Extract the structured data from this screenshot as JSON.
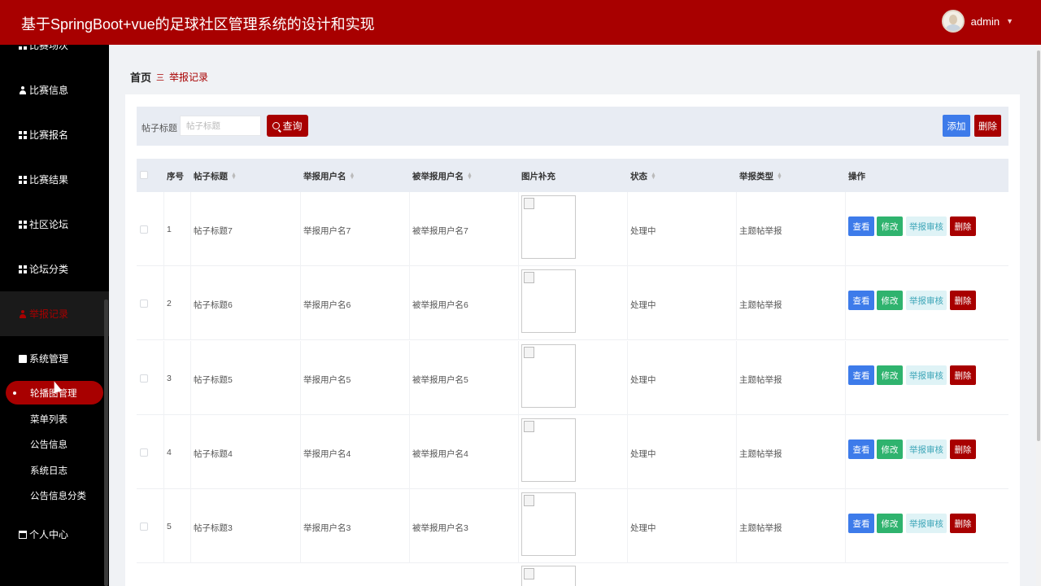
{
  "header": {
    "title": "基于SpringBoot+vue的足球社区管理系统的设计和实现",
    "user_name": "admin"
  },
  "sidebar": {
    "items": [
      {
        "label": "比赛场次",
        "icon": "grid-icon"
      },
      {
        "label": "比赛信息",
        "icon": "user-icon"
      },
      {
        "label": "比赛报名",
        "icon": "grid-icon"
      },
      {
        "label": "比赛结果",
        "icon": "grid-icon"
      },
      {
        "label": "社区论坛",
        "icon": "grid-icon"
      },
      {
        "label": "论坛分类",
        "icon": "grid-icon"
      },
      {
        "label": "举报记录",
        "icon": "user-icon",
        "active": true
      },
      {
        "label": "系统管理",
        "icon": "document-icon"
      }
    ],
    "sub_items": [
      {
        "label": "轮播图管理",
        "active": true
      },
      {
        "label": "菜单列表"
      },
      {
        "label": "公告信息"
      },
      {
        "label": "系统日志"
      },
      {
        "label": "公告信息分类"
      }
    ],
    "personal": {
      "label": "个人中心",
      "icon": "calendar-icon"
    }
  },
  "breadcrumb": {
    "home": "首页",
    "separator": "三",
    "current": "举报记录"
  },
  "toolbar": {
    "search_label": "帖子标题",
    "search_placeholder": "帖子标题",
    "search_button": "查询",
    "add_button": "添加",
    "delete_button": "删除"
  },
  "table": {
    "headers": {
      "index": "序号",
      "post_title": "帖子标题",
      "reporter": "举报用户名",
      "reported": "被举报用户名",
      "image": "图片补充",
      "status": "状态",
      "report_type": "举报类型",
      "actions": "操作"
    },
    "actions": {
      "view": "查看",
      "edit": "修改",
      "audit": "举报审核",
      "delete": "删除"
    },
    "rows": [
      {
        "index": "1",
        "post_title": "帖子标题7",
        "reporter": "举报用户名7",
        "reported": "被举报用户名7",
        "status": "处理中",
        "report_type": "主题帖举报"
      },
      {
        "index": "2",
        "post_title": "帖子标题6",
        "reporter": "举报用户名6",
        "reported": "被举报用户名6",
        "status": "处理中",
        "report_type": "主题帖举报"
      },
      {
        "index": "3",
        "post_title": "帖子标题5",
        "reporter": "举报用户名5",
        "reported": "被举报用户名5",
        "status": "处理中",
        "report_type": "主题帖举报"
      },
      {
        "index": "4",
        "post_title": "帖子标题4",
        "reporter": "举报用户名4",
        "reported": "被举报用户名4",
        "status": "处理中",
        "report_type": "主题帖举报"
      },
      {
        "index": "5",
        "post_title": "帖子标题3",
        "reporter": "举报用户名3",
        "reported": "被举报用户名3",
        "status": "处理中",
        "report_type": "主题帖举报"
      }
    ]
  },
  "colors": {
    "brand": "#a80000",
    "view_button": "#3d7bea",
    "edit_button": "#2fb36e",
    "audit_button_bg": "#dff3f6"
  }
}
